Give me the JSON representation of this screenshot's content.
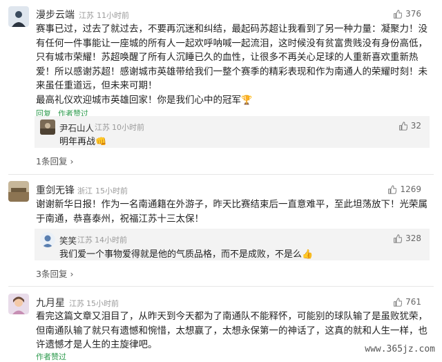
{
  "comments": [
    {
      "user": "漫步云端",
      "location": "江苏",
      "time": "11小时前",
      "likes": "376",
      "lines": [
        "赛事已过，过去了就过去，不要再沉迷和纠结，最起码苏超让我看到了另一种力量：凝聚力！没",
        "有任何一件事能让一座城的所有人一起欢呼呐喊一起流泪，这时候没有贫富贵贱没有身份高低，",
        "只有城市荣耀！苏超唤醒了所有人沉睡已久的血性，让很多不再关心足球的人重新喜欢重新热",
        "爱！所以感谢苏超！感谢城市英雄带给我们一整个赛季的精彩表现和作为南通人的荣耀时刻！未",
        "来虽任重道远，但未来可期！",
        "最高礼仪欢迎城市英雄回家！你是我们心中的冠军"
      ],
      "trophy": "🏆",
      "action_reply": "回复",
      "action_author": "作者赞过",
      "reply": {
        "user": "尹石山人",
        "location": "江苏",
        "time": "10小时前",
        "likes": "32",
        "text": "明年再战",
        "emoji": "👊"
      },
      "more": "1条回复"
    },
    {
      "user": "重剑无锋",
      "location": "浙江",
      "time": "15小时前",
      "likes": "1269",
      "lines": [
        "谢谢新华日报！作为一名南通籍在外游子，昨天比赛结束后一直意难平，至此坦荡放下！光荣属",
        "于南通，恭喜泰州，祝福江苏十三太保！"
      ],
      "reply": {
        "user": "笑笑",
        "location": "江苏",
        "time": "14小时前",
        "likes": "328",
        "text": "我们爱一个事物爱得就是他的气质品格，而不是成败，不是么",
        "emoji": "👍"
      },
      "more": "3条回复"
    },
    {
      "user": "九月星",
      "location": "江苏",
      "time": "15小时前",
      "likes": "761",
      "lines": [
        "看完这篇文章又泪目了，从昨天到今天都为了南通队不能释怀，可能别的球队输了是虽败犹荣，",
        "但南通队输了就只有遗憾和惋惜，太想赢了，太想永保第一的神话了，这真的就和人生一样，也",
        "许遗憾才是人生的主旋律吧。"
      ],
      "action_author": "作者赞过"
    }
  ],
  "watermark": "www.365jz.com",
  "icons": {
    "like": "thumbs-up-icon",
    "more": "chevron-right-icon"
  },
  "colors": {
    "green": "#2e9b4e",
    "meta": "#9a9a9a",
    "reply_bg": "#f3f3f3"
  }
}
